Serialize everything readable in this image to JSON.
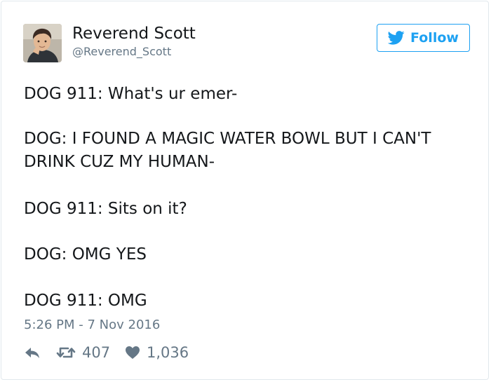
{
  "author": {
    "display_name": "Reverend Scott",
    "handle": "@Reverend_Scott"
  },
  "follow_button": {
    "label": "Follow",
    "icon": "twitter-bird-icon"
  },
  "tweet": {
    "lines": [
      "DOG 911: What's ur emer-",
      "DOG: I FOUND A MAGIC WATER BOWL BUT I CAN'T",
      "DRINK CUZ MY HUMAN-",
      "DOG 911: Sits on it?",
      "DOG: OMG YES",
      "DOG 911: OMG"
    ],
    "timestamp": "5:26 PM - 7 Nov 2016"
  },
  "actions": {
    "reply": {
      "icon": "reply-icon"
    },
    "retweet": {
      "icon": "retweet-icon",
      "count": "407"
    },
    "like": {
      "icon": "heart-icon",
      "count": "1,036"
    }
  },
  "colors": {
    "accent": "#1da1f2",
    "text": "#14171a",
    "secondary": "#657786",
    "border": "#e1e8ed"
  }
}
